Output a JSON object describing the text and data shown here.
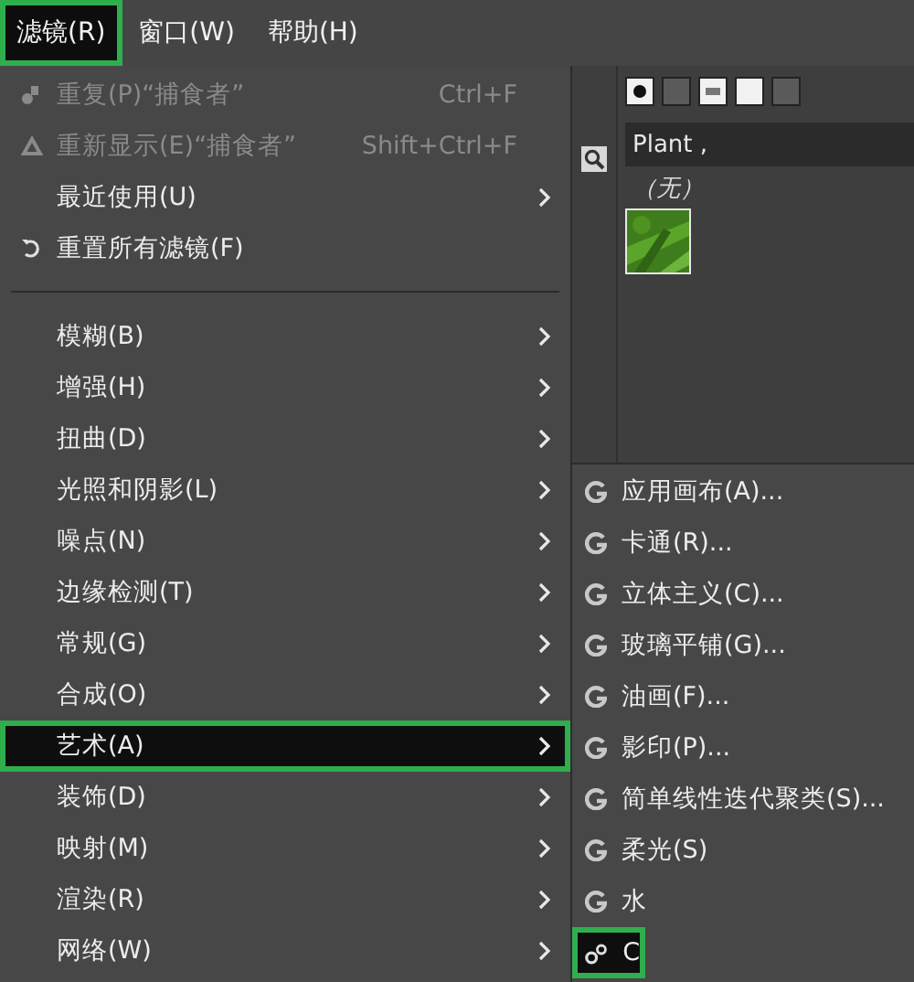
{
  "menubar": [
    {
      "label": "滤镜(R)",
      "selected": true
    },
    {
      "label": "窗口(W)",
      "selected": false
    },
    {
      "label": "帮助(H)",
      "selected": false
    }
  ],
  "filters_menu": [
    {
      "kind": "action",
      "label": "重复(P)“捕食者”",
      "shortcut": "Ctrl+F",
      "disabled": true,
      "selected": false
    },
    {
      "kind": "action",
      "label": "重新显示(E)“捕食者”",
      "shortcut": "Shift+Ctrl+F",
      "disabled": true,
      "selected": false
    },
    {
      "kind": "submenu",
      "label": "最近使用(U)",
      "disabled": false,
      "selected": false
    },
    {
      "kind": "action",
      "label": "重置所有滤镜(F)",
      "disabled": false,
      "selected": false
    },
    {
      "kind": "separator"
    },
    {
      "kind": "submenu",
      "label": "模糊(B)",
      "disabled": false,
      "selected": false
    },
    {
      "kind": "submenu",
      "label": "增强(H)",
      "disabled": false,
      "selected": false
    },
    {
      "kind": "submenu",
      "label": "扭曲(D)",
      "disabled": false,
      "selected": false
    },
    {
      "kind": "submenu",
      "label": "光照和阴影(L)",
      "disabled": false,
      "selected": false
    },
    {
      "kind": "submenu",
      "label": "噪点(N)",
      "disabled": false,
      "selected": false
    },
    {
      "kind": "submenu",
      "label": "边缘检测(T)",
      "disabled": false,
      "selected": false
    },
    {
      "kind": "submenu",
      "label": "常规(G)",
      "disabled": false,
      "selected": false
    },
    {
      "kind": "submenu",
      "label": "合成(O)",
      "disabled": false,
      "selected": false
    },
    {
      "kind": "submenu",
      "label": "艺术(A)",
      "disabled": false,
      "selected": true
    },
    {
      "kind": "submenu",
      "label": "装饰(D)",
      "disabled": false,
      "selected": false
    },
    {
      "kind": "submenu",
      "label": "映射(M)",
      "disabled": false,
      "selected": false
    },
    {
      "kind": "submenu",
      "label": "渲染(R)",
      "disabled": false,
      "selected": false
    },
    {
      "kind": "submenu",
      "label": "网络(W)",
      "disabled": false,
      "selected": false
    }
  ],
  "brush_panel": {
    "tag_field": "Plant ,",
    "selection": "（无）"
  },
  "artistic_submenu": [
    {
      "kind": "gegl",
      "label": "应用画布(A)...",
      "selected": false
    },
    {
      "kind": "gegl",
      "label": "卡通(R)...",
      "selected": false
    },
    {
      "kind": "gegl",
      "label": "立体主义(C)...",
      "selected": false
    },
    {
      "kind": "gegl",
      "label": "玻璃平铺(G)...",
      "selected": false
    },
    {
      "kind": "gegl",
      "label": "油画(F)...",
      "selected": false
    },
    {
      "kind": "gegl",
      "label": "影印(P)...",
      "selected": false
    },
    {
      "kind": "gegl",
      "label": "简单线性迭代聚类(S)...",
      "selected": false
    },
    {
      "kind": "gegl",
      "label": "柔光(S)",
      "selected": false
    },
    {
      "kind": "gegl",
      "label": "水",
      "selected": false
    },
    {
      "kind": "plugin",
      "label": "C",
      "selected": true
    }
  ]
}
